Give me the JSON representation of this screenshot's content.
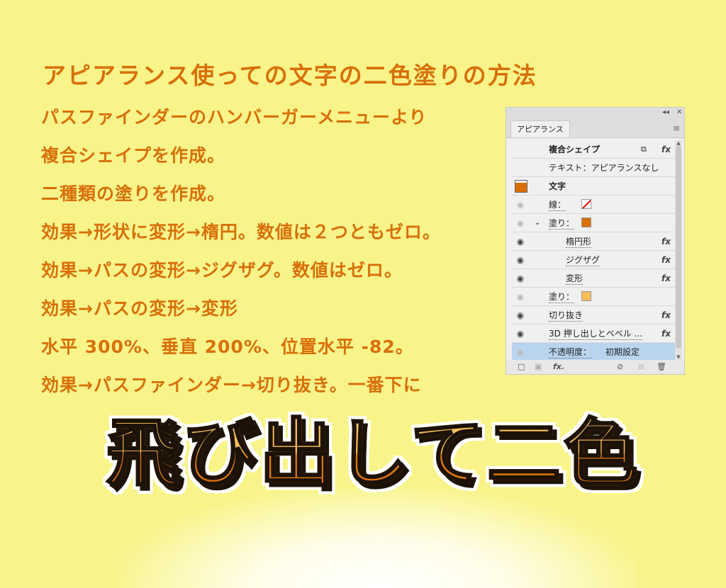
{
  "heading": "アピアランス使っての文字の二色塗りの方法",
  "steps": [
    "パスファインダーのハンバーガーメニューより",
    "複合シェイプを作成。",
    "二種類の塗りを作成。",
    "効果→形状に変形→楕円。数値は２つともゼロ。",
    "効果→パスの変形→ジグザグ。数値はゼロ。",
    "効果→パスの変形→変形",
    "水平 300%、垂直 200%、位置水平 -82。",
    "効果→パスファインダー→切り抜き。一番下に"
  ],
  "panel": {
    "tab_label": "アピアランス",
    "rows": [
      {
        "label": "複合シェイプ",
        "fx": "fx",
        "eye": "none"
      },
      {
        "label": "テキスト：アピアランスなし",
        "eye": "none"
      },
      {
        "label": "文字",
        "eye": "chip"
      },
      {
        "label": "線：",
        "eye": "dim"
      },
      {
        "label": "塗り：",
        "eye": "dim"
      },
      {
        "label": "楕円形",
        "fx": "fx",
        "eye": "on"
      },
      {
        "label": "ジグザグ",
        "fx": "fx",
        "eye": "on"
      },
      {
        "label": "変形",
        "fx": "fx",
        "eye": "on"
      },
      {
        "label": "塗り：",
        "eye": "dim"
      },
      {
        "label": "切り抜き",
        "fx": "fx",
        "eye": "on"
      },
      {
        "label": "3D 押し出しとベベル ...",
        "fx": "fx",
        "eye": "on"
      },
      {
        "label": "不透明度：",
        "value": "初期設定",
        "eye": "dim"
      }
    ],
    "bottom_fx": "fx."
  },
  "big_text": "飛び出して二色",
  "colors": {
    "background": "#f8f48a",
    "accent": "#d8700a",
    "fill_dark": "#d96f06",
    "fill_light": "#fbbd55",
    "selection": "#b9d4ef"
  }
}
